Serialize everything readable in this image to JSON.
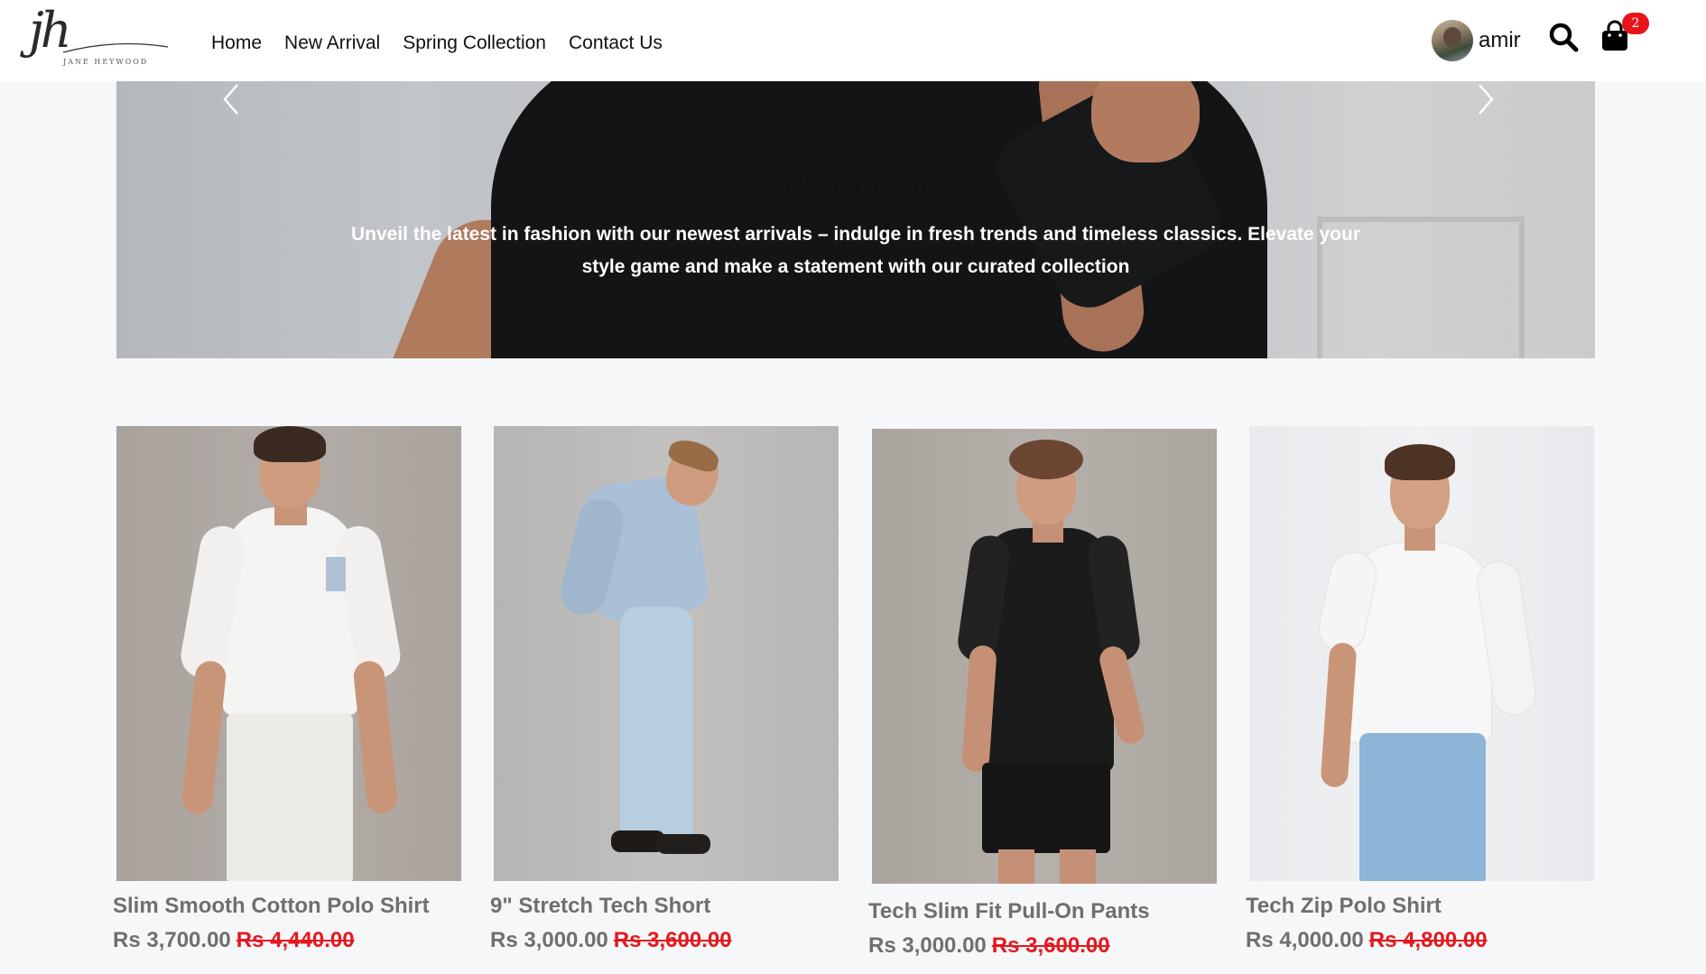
{
  "brand": {
    "logo_initials": "jh",
    "logo_subtitle": "JANE HEYWOOD"
  },
  "nav": {
    "items": [
      "Home",
      "New Arrival",
      "Spring Collection",
      "Contact Us"
    ]
  },
  "user": {
    "name": "amir"
  },
  "cart": {
    "count": "2"
  },
  "hero": {
    "title": "New Arrival",
    "text": "Unveil the latest in fashion with our newest arrivals – indulge in fresh trends and timeless classics. Elevate your style game and make a statement with our curated collection"
  },
  "products": [
    {
      "name": "Slim Smooth Cotton Polo Shirt",
      "price": "Rs 3,700.00",
      "old_price": "Rs 4,440.00"
    },
    {
      "name": "9\" Stretch Tech Short",
      "price": "Rs 3,000.00",
      "old_price": "Rs 3,600.00"
    },
    {
      "name": "Tech Slim Fit Pull-On Pants",
      "price": "Rs 3,000.00",
      "old_price": "Rs 3,600.00"
    },
    {
      "name": "Tech Zip Polo Shirt",
      "price": "Rs 4,000.00",
      "old_price": "Rs 4,800.00"
    }
  ],
  "colors": {
    "sale_red": "#e3191f",
    "badge_red": "#e8141a",
    "muted_text": "#6f6f6f"
  },
  "icons": [
    "search-icon",
    "cart-icon",
    "chevron-left-icon",
    "chevron-right-icon"
  ]
}
